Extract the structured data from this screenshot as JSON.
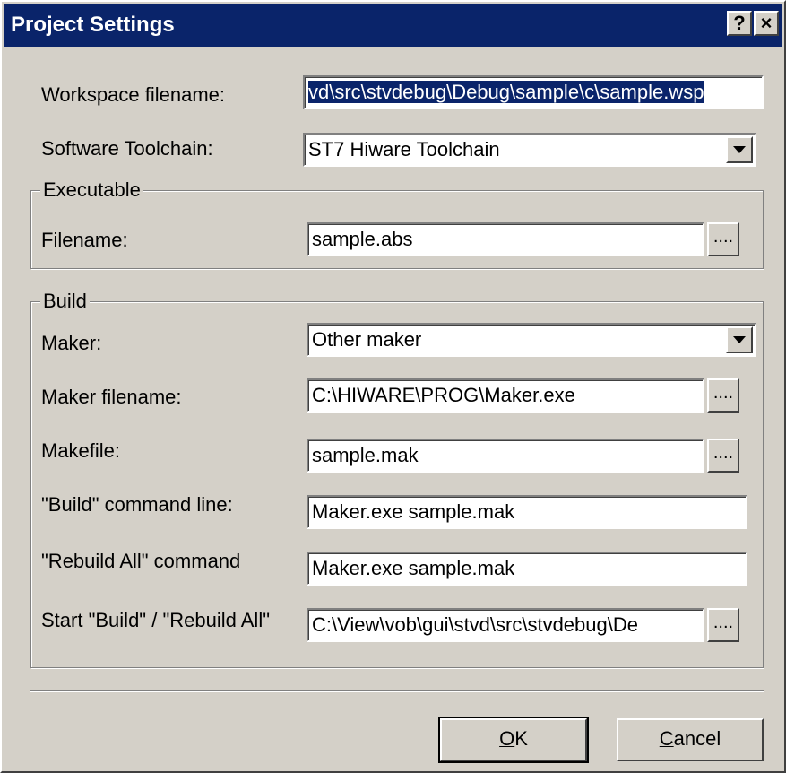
{
  "window": {
    "title": "Project Settings",
    "help_label": "?",
    "close_label": "×"
  },
  "workspace": {
    "label": "Workspace filename:",
    "value": "vd\\src\\stvdebug\\Debug\\sample\\c\\sample.wsp"
  },
  "toolchain": {
    "label": "Software Toolchain:",
    "value": "ST7 Hiware Toolchain"
  },
  "executable": {
    "group_title": "Executable",
    "filename_label": "Filename:",
    "filename_value": "sample.abs",
    "browse_label": "...."
  },
  "build": {
    "group_title": "Build",
    "maker_label": "Maker:",
    "maker_value": "Other maker",
    "maker_filename_label": "Maker filename:",
    "maker_filename_value": "C:\\HIWARE\\PROG\\Maker.exe",
    "makefile_label": "Makefile:",
    "makefile_value": "sample.mak",
    "build_cmd_label": "\"Build\" command line:",
    "build_cmd_value": "Maker.exe sample.mak",
    "rebuild_cmd_label": "\"Rebuild All\" command",
    "rebuild_cmd_value": "Maker.exe sample.mak",
    "start_label": "Start \"Build\" / \"Rebuild All\"",
    "start_value": "C:\\View\\vob\\gui\\stvd\\src\\stvdebug\\De",
    "browse_label": "...."
  },
  "buttons": {
    "ok_mnemonic": "O",
    "ok_rest": "K",
    "cancel_mnemonic": "C",
    "cancel_rest": "ancel"
  },
  "colors": {
    "titlebar": "#0a246a",
    "face": "#d4d0c8",
    "selection": "#0a246a"
  }
}
